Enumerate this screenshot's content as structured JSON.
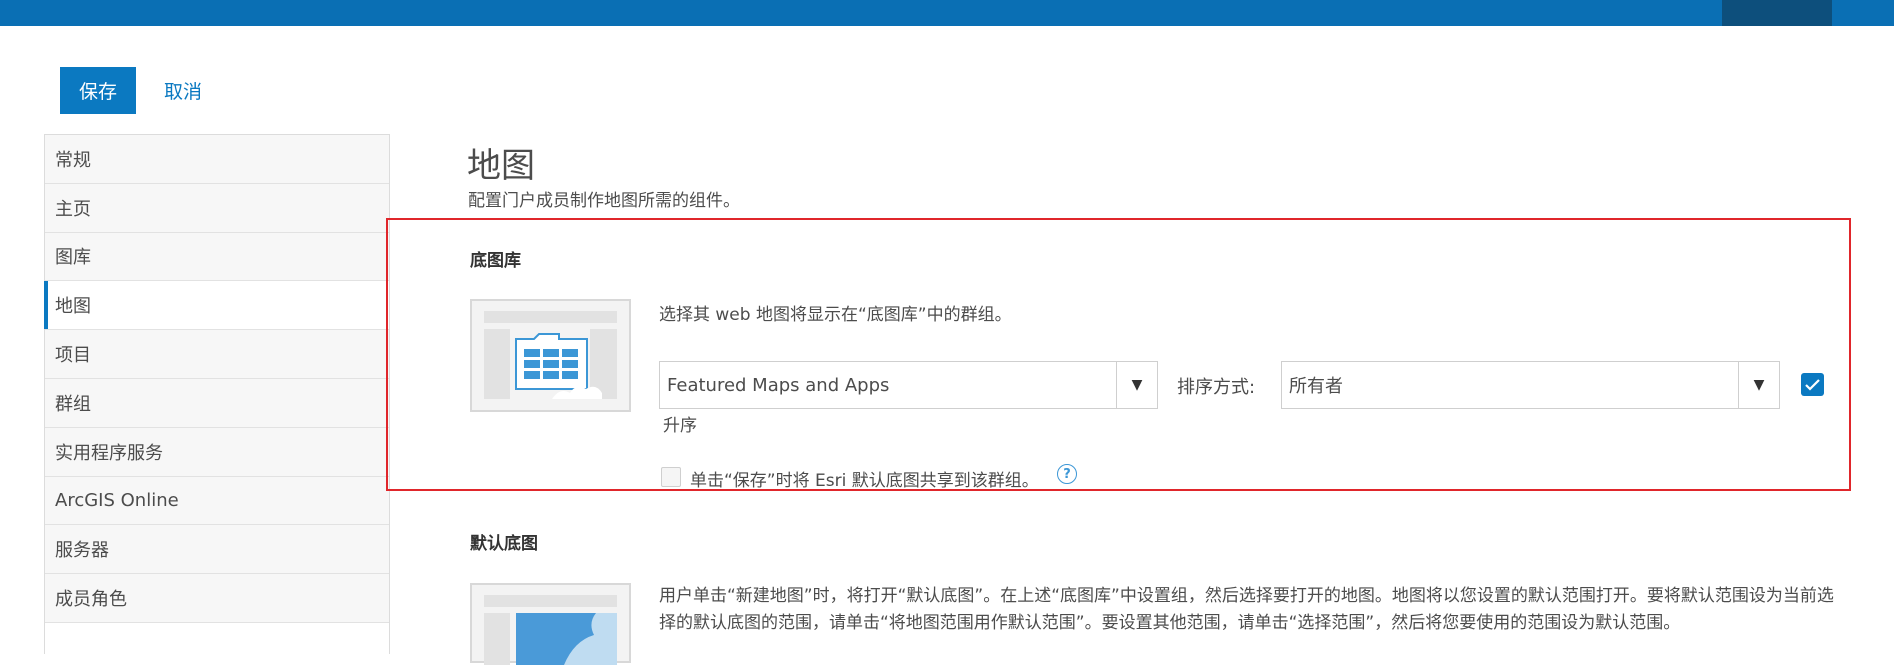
{
  "toolbar": {
    "save_label": "保存",
    "cancel_label": "取消"
  },
  "sidebar": {
    "items": [
      {
        "label": "常规"
      },
      {
        "label": "主页"
      },
      {
        "label": "图库"
      },
      {
        "label": "地图",
        "active": true
      },
      {
        "label": "项目"
      },
      {
        "label": "群组"
      },
      {
        "label": "实用程序服务"
      },
      {
        "label": "ArcGIS Online"
      },
      {
        "label": "服务器"
      },
      {
        "label": "成员角色"
      }
    ]
  },
  "main": {
    "title": "地图",
    "description": "配置门户成员制作地图所需的组件。",
    "basemap_gallery": {
      "title": "底图库",
      "instruction": "选择其 web 地图将显示在“底图库”中的群组。",
      "group_select": {
        "value": "Featured Maps and Apps"
      },
      "sort_label": "排序方式:",
      "sort_select": {
        "value": "所有者"
      },
      "ascending_checked": true,
      "order_label": "升序",
      "share_checkbox": {
        "checked": false,
        "label": "单击“保存”时将 Esri 默认底图共享到该群组。"
      }
    },
    "default_basemap": {
      "title": "默认底图",
      "description": "用户单击“新建地图”时，将打开“默认底图”。在上述“底图库”中设置组，然后选择要打开的地图。地图将以您设置的默认范围打开。要将默认范围设为当前选择的默认底图的范围，请单击“将地图范围用作默认范围”。要设置其他范围，请单击“选择范围”，然后将您要使用的范围设为默认范围。"
    }
  },
  "colors": {
    "accent": "#0b79c1",
    "highlight_border": "#e0262b",
    "topbar": "#0a6fb4"
  },
  "icons": {
    "dropdown": "triangle-down",
    "checkbox": "check",
    "help": "question-circle"
  }
}
